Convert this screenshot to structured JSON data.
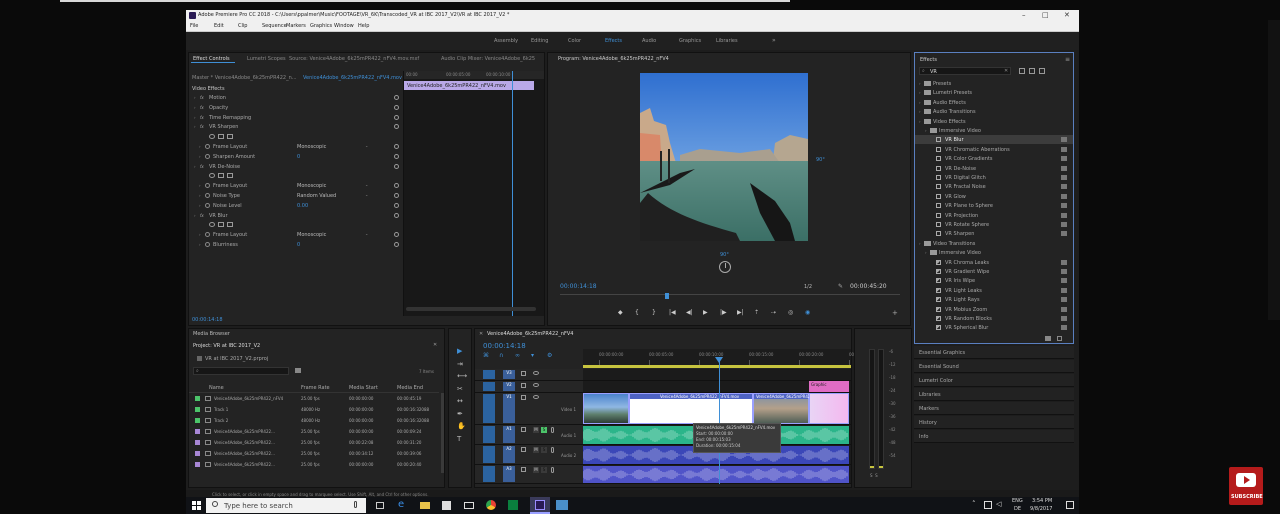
{
  "app": {
    "title": "Adobe Premiere Pro CC 2018 - C:\\Users\\ppalmer\\Music\\FOOTAGE\\VR_6K\\Transcoded_VR at IBC 2017_V2\\VR at IBC 2017_V2 *",
    "menu": [
      "File",
      "Edit",
      "Clip",
      "Sequence",
      "Markers",
      "Graphics",
      "Window",
      "Help"
    ],
    "workspaces": [
      "Assembly",
      "Editing",
      "Color",
      "Effects",
      "Audio",
      "Graphics",
      "Libraries"
    ],
    "active_workspace": "Effects",
    "more_glyph": "»",
    "win_min": "–",
    "win_max": "□",
    "win_close": "✕"
  },
  "source_panel": {
    "tabs": [
      "Effect Controls",
      "Lumetri Scopes",
      "Source: Venice4Adobe_6k25mPR422_nFV4.mov.mxf",
      "Audio Clip Mixer: Venice4Adobe_6k25"
    ],
    "master_label": "Master * Venice4Adobe_6k25mPR422_n...",
    "clip_label": "Venice4Adobe_6k25mPR422_nFV4.mov",
    "mini_clip_label": "Venice4Adobe_6k25mPR422_nFV4.mov",
    "mini_times": [
      "00:00",
      "00:00:05:00",
      "00:00:10:00"
    ],
    "video_effects_label": "Video Effects",
    "rows": [
      {
        "label": "Motion",
        "indent": 1,
        "value": ""
      },
      {
        "label": "Opacity",
        "indent": 1,
        "value": ""
      },
      {
        "label": "Time Remapping",
        "indent": 1,
        "value": ""
      },
      {
        "label": "VR Sharpen",
        "indent": 1,
        "value": ""
      },
      {
        "label": "",
        "indent": 2,
        "value": ""
      },
      {
        "label": "Frame Layout",
        "indent": 2,
        "value": "Monoscopic"
      },
      {
        "label": "Sharpen Amount",
        "indent": 2,
        "value": "0"
      },
      {
        "label": "VR De-Noise",
        "indent": 1,
        "value": ""
      },
      {
        "label": "",
        "indent": 2,
        "value": ""
      },
      {
        "label": "Frame Layout",
        "indent": 2,
        "value": "Monoscopic"
      },
      {
        "label": "Noise Type",
        "indent": 2,
        "value": "Random Valued"
      },
      {
        "label": "Noise Level",
        "indent": 2,
        "value": "0.00"
      },
      {
        "label": "VR Blur",
        "indent": 1,
        "value": ""
      },
      {
        "label": "",
        "indent": 2,
        "value": ""
      },
      {
        "label": "Frame Layout",
        "indent": 2,
        "value": "Monoscopic"
      },
      {
        "label": "Blurriness",
        "indent": 2,
        "value": "0"
      }
    ],
    "timecode": "00:00:14:18"
  },
  "program": {
    "title": "Program: Venice4Adobe_6k25mPR422_nFV4",
    "timecode": "00:00:14:18",
    "fit": "1/2",
    "duration": "00:00:45:20",
    "angle_right": "90°",
    "angle_bottom": "90°"
  },
  "effects_panel": {
    "title": "Effects",
    "search_value": "VR",
    "tree": [
      {
        "label": "Presets",
        "level": 0,
        "type": "folder"
      },
      {
        "label": "Lumetri Presets",
        "level": 0,
        "type": "folder"
      },
      {
        "label": "Audio Effects",
        "level": 0,
        "type": "folder"
      },
      {
        "label": "Audio Transitions",
        "level": 0,
        "type": "folder"
      },
      {
        "label": "Video Effects",
        "level": 0,
        "type": "folder"
      },
      {
        "label": "Immersive Video",
        "level": 1,
        "type": "folder"
      },
      {
        "label": "VR Blur",
        "level": 2,
        "type": "fx",
        "selected": true
      },
      {
        "label": "VR Chromatic Aberrations",
        "level": 2,
        "type": "fx"
      },
      {
        "label": "VR Color Gradients",
        "level": 2,
        "type": "fx"
      },
      {
        "label": "VR De-Noise",
        "level": 2,
        "type": "fx"
      },
      {
        "label": "VR Digital Glitch",
        "level": 2,
        "type": "fx"
      },
      {
        "label": "VR Fractal Noise",
        "level": 2,
        "type": "fx"
      },
      {
        "label": "VR Glow",
        "level": 2,
        "type": "fx"
      },
      {
        "label": "VR Plane to Sphere",
        "level": 2,
        "type": "fx"
      },
      {
        "label": "VR Projection",
        "level": 2,
        "type": "fx"
      },
      {
        "label": "VR Rotate Sphere",
        "level": 2,
        "type": "fx"
      },
      {
        "label": "VR Sharpen",
        "level": 2,
        "type": "fx"
      },
      {
        "label": "Video Transitions",
        "level": 0,
        "type": "folder"
      },
      {
        "label": "Immersive Video",
        "level": 1,
        "type": "folder"
      },
      {
        "label": "VR Chroma Leaks",
        "level": 2,
        "type": "tr"
      },
      {
        "label": "VR Gradient Wipe",
        "level": 2,
        "type": "tr"
      },
      {
        "label": "VR Iris Wipe",
        "level": 2,
        "type": "tr"
      },
      {
        "label": "VR Light Leaks",
        "level": 2,
        "type": "tr"
      },
      {
        "label": "VR Light Rays",
        "level": 2,
        "type": "tr"
      },
      {
        "label": "VR Mobius Zoom",
        "level": 2,
        "type": "tr"
      },
      {
        "label": "VR Random Blocks",
        "level": 2,
        "type": "tr"
      },
      {
        "label": "VR Spherical Blur",
        "level": 2,
        "type": "tr"
      }
    ],
    "collapsed": [
      "Essential Graphics",
      "Essential Sound",
      "Lumetri Color",
      "Libraries",
      "Markers",
      "History",
      "Info"
    ]
  },
  "project": {
    "tabs": [
      "Media Browser"
    ],
    "title": "Project: VR at IBC 2017_V2",
    "file": "VR at IBC 2017_V2.prproj",
    "items_count": "7 Items",
    "columns": [
      "Name",
      "Frame Rate",
      "Media Start",
      "Media End"
    ],
    "rows": [
      {
        "color": "#4cc46a",
        "name": "Venice4Adobe_6k25mPR422_nFV4",
        "rate": "25.00 fps",
        "start": "00:00:00:00",
        "end": "00:00:45:19"
      },
      {
        "color": "#4cc46a",
        "name": "Track 1",
        "rate": "48000 Hz",
        "start": "00:00:00:00",
        "end": "00:00:16:32088"
      },
      {
        "color": "#4cc46a",
        "name": "Track 2",
        "rate": "48000 Hz",
        "start": "00:00:00:00",
        "end": "00:00:16:32088"
      },
      {
        "color": "#a887d6",
        "name": "Venice4Adobe_6k25mPR422...",
        "rate": "25.00 fps",
        "start": "00:00:00:00",
        "end": "00:00:09:24"
      },
      {
        "color": "#a887d6",
        "name": "Venice4Adobe_6k25mPR422...",
        "rate": "25.00 fps",
        "start": "00:00:22:08",
        "end": "00:00:31:20"
      },
      {
        "color": "#a887d6",
        "name": "Venice4Adobe_6k25mPR422...",
        "rate": "25.00 fps",
        "start": "00:00:34:12",
        "end": "00:00:39:06"
      },
      {
        "color": "#a887d6",
        "name": "Venice4Adobe_6k25mPR422...",
        "rate": "25.00 fps",
        "start": "00:00:00:00",
        "end": "00:00:20:40"
      }
    ]
  },
  "timeline": {
    "title": "Venice4Adobe_6k25mPR422_nFV4",
    "timecode": "00:00:14:18",
    "ruler": [
      "00:00:00:00",
      "00:00:05:00",
      "00:00:10:00",
      "00:00:15:00",
      "00:00:20:00",
      "00:00:25:00"
    ],
    "tracks": [
      "V3",
      "V2",
      "V1",
      "A1",
      "A2",
      "A3"
    ],
    "track_names": {
      "v1": "Video 1",
      "a1": "Audio 1",
      "a2": "Audio 2"
    },
    "clip_label": "Venice4Adobe_6k25mPR422_nFV4.mov",
    "tooltip": {
      "name": "Venice4Adobe_6k25mPR422_nFV4.mov",
      "start": "Start: 00:00:00:00",
      "end": "End: 00:00:15:03",
      "duration": "Duration: 00:00:15:04"
    },
    "graphic_label": "Graphic"
  },
  "meter": {
    "labels": [
      "-6",
      "-12",
      "-18",
      "-24",
      "-30",
      "-36",
      "-42",
      "-48",
      "-54"
    ],
    "bottom": "S  S"
  },
  "status_bar": "Click to select, or click in empty space and drag to marquee select. Use Shift, Alt, and Ctrl for other options.",
  "taskbar": {
    "search_placeholder": "Type here to search",
    "lang": "ENG",
    "locale": "DE",
    "time": "3:54 PM",
    "date": "9/8/2017"
  },
  "subscribe": "SUBSCRIBE",
  "colors": {
    "accent": "#3f8fd6",
    "clip_blue": "#4e63c4",
    "audio_green": "#2bb58a",
    "graphic_pink": "#e06cc4",
    "selection": "#9aa0ff"
  }
}
